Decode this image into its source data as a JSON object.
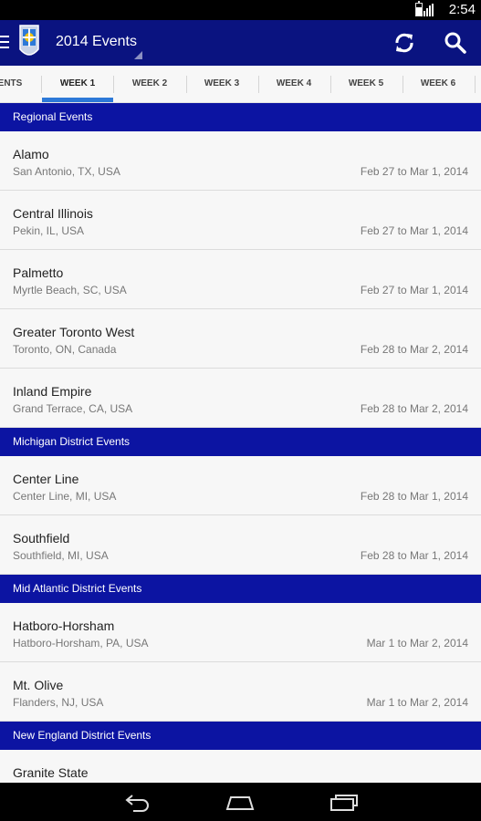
{
  "status_bar": {
    "time": "2:54"
  },
  "action_bar": {
    "title": "2014 Events",
    "icons": [
      "menu-icon",
      "logo-icon",
      "refresh-icon",
      "search-icon"
    ]
  },
  "tabs": [
    {
      "label": "ENTS"
    },
    {
      "label": "WEEK 1"
    },
    {
      "label": "WEEK 2"
    },
    {
      "label": "WEEK 3"
    },
    {
      "label": "WEEK 4"
    },
    {
      "label": "WEEK 5"
    },
    {
      "label": "WEEK 6"
    }
  ],
  "selected_tab": "WEEK 1",
  "sections": [
    {
      "title": "Regional Events",
      "events": [
        {
          "name": "Alamo",
          "location": "San Antonio, TX, USA",
          "dates": "Feb 27 to Mar 1, 2014"
        },
        {
          "name": "Central Illinois",
          "location": "Pekin, IL, USA",
          "dates": "Feb 27 to Mar 1, 2014"
        },
        {
          "name": "Palmetto",
          "location": "Myrtle Beach, SC, USA",
          "dates": "Feb 27 to Mar 1, 2014"
        },
        {
          "name": "Greater Toronto West",
          "location": "Toronto, ON, Canada",
          "dates": "Feb 28 to Mar 2, 2014"
        },
        {
          "name": "Inland Empire",
          "location": "Grand Terrace, CA, USA",
          "dates": "Feb 28 to Mar 2, 2014"
        }
      ]
    },
    {
      "title": "Michigan District Events",
      "events": [
        {
          "name": "Center Line",
          "location": "Center Line, MI, USA",
          "dates": "Feb 28 to Mar 1, 2014"
        },
        {
          "name": "Southfield",
          "location": "Southfield, MI, USA",
          "dates": "Feb 28 to Mar 1, 2014"
        }
      ]
    },
    {
      "title": "Mid Atlantic District Events",
      "events": [
        {
          "name": "Hatboro-Horsham",
          "location": "Hatboro-Horsham, PA, USA",
          "dates": "Mar 1 to Mar 2, 2014"
        },
        {
          "name": "Mt. Olive",
          "location": "Flanders, NJ, USA",
          "dates": "Mar 1 to Mar 2, 2014"
        }
      ]
    },
    {
      "title": "New England District Events",
      "events": [
        {
          "name": "Granite State",
          "location": "",
          "dates": ""
        }
      ]
    }
  ],
  "nav_bar": {
    "icons": [
      "back-icon",
      "home-icon",
      "recents-icon"
    ]
  },
  "colors": {
    "action_bar": "#0a1380",
    "section_header": "#0c14a2",
    "tab_indicator": "#2d79d8"
  }
}
